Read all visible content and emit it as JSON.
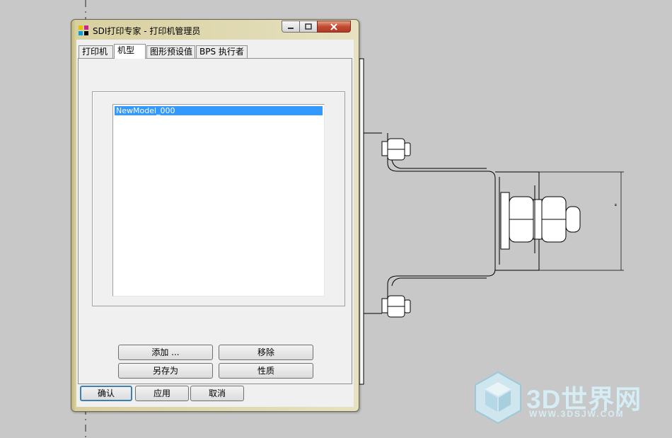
{
  "window": {
    "title": "SDI打印专家 - 打印机管理员"
  },
  "tabs": [
    {
      "label": "打印机",
      "active": false
    },
    {
      "label": "机型",
      "active": true
    },
    {
      "label": "图形预设值",
      "active": false
    },
    {
      "label": "BPS 执行者",
      "active": false
    }
  ],
  "model_list": {
    "items": [
      {
        "label": "NewModel_000",
        "selected": true
      }
    ]
  },
  "buttons": {
    "add": "添加 ...",
    "remove": "移除",
    "save_as": "另存为",
    "properties": "性质"
  },
  "footer": {
    "ok": "确认",
    "apply": "应用",
    "cancel": "取消"
  },
  "drawing": {
    "dimension_text": "\""
  },
  "watermark": {
    "title": "3D世界网",
    "url": "WWW.3DSJW.COM"
  },
  "colors": {
    "selection": "#3399ff",
    "close_button": "#c24a33",
    "watermark": "#d7ecf3"
  }
}
